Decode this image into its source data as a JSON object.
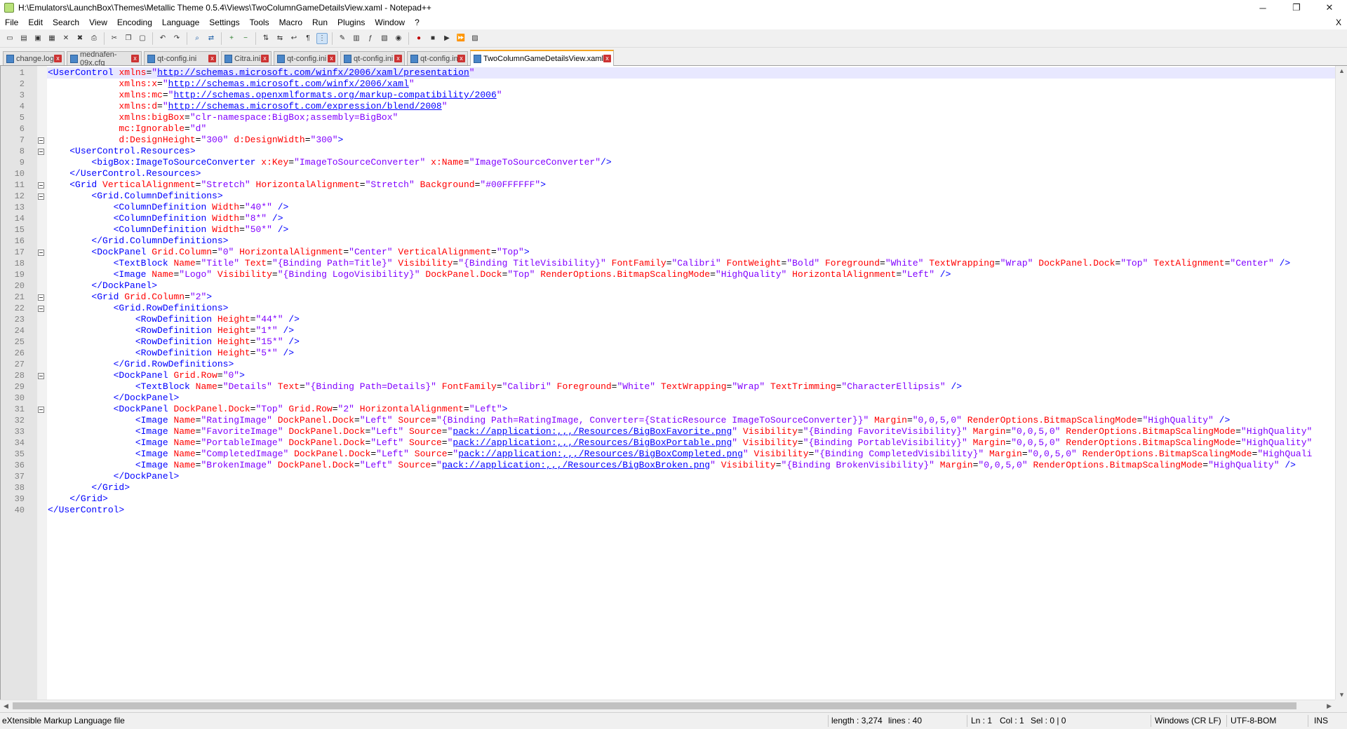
{
  "window": {
    "title": "H:\\Emulators\\LaunchBox\\Themes\\Metallic Theme 0.5.4\\Views\\TwoColumnGameDetailsView.xaml - Notepad++",
    "controls": [
      "─",
      "❐",
      "✕"
    ]
  },
  "menu": {
    "items": [
      "File",
      "Edit",
      "Search",
      "View",
      "Encoding",
      "Language",
      "Settings",
      "Tools",
      "Macro",
      "Run",
      "Plugins",
      "Window",
      "?"
    ],
    "close_label": "X"
  },
  "tabs": [
    {
      "label": "change.log",
      "active": false
    },
    {
      "label": "mednafen-09x.cfg",
      "active": false
    },
    {
      "label": "qt-config.ini",
      "active": false
    },
    {
      "label": "Citra.ini",
      "active": false
    },
    {
      "label": "qt-config.ini",
      "active": false
    },
    {
      "label": "qt-config.ini",
      "active": false
    },
    {
      "label": "qt-config.ini",
      "active": false
    },
    {
      "label": "TwoColumnGameDetailsView.xaml",
      "active": true
    }
  ],
  "tab_close_glyph": "x",
  "code_lines": [
    "<UserControl xmlns=\"http://schemas.microsoft.com/winfx/2006/xaml/presentation\"",
    "             xmlns:x=\"http://schemas.microsoft.com/winfx/2006/xaml\"",
    "             xmlns:mc=\"http://schemas.openxmlformats.org/markup-compatibility/2006\"",
    "             xmlns:d=\"http://schemas.microsoft.com/expression/blend/2008\"",
    "             xmlns:bigBox=\"clr-namespace:BigBox;assembly=BigBox\"",
    "             mc:Ignorable=\"d\"",
    "             d:DesignHeight=\"300\" d:DesignWidth=\"300\">",
    "    <UserControl.Resources>",
    "        <bigBox:ImageToSourceConverter x:Key=\"ImageToSourceConverter\" x:Name=\"ImageToSourceConverter\"/>",
    "    </UserControl.Resources>",
    "    <Grid VerticalAlignment=\"Stretch\" HorizontalAlignment=\"Stretch\" Background=\"#00FFFFFF\">",
    "        <Grid.ColumnDefinitions>",
    "            <ColumnDefinition Width=\"40*\" />",
    "            <ColumnDefinition Width=\"8*\" />",
    "            <ColumnDefinition Width=\"50*\" />",
    "        </Grid.ColumnDefinitions>",
    "        <DockPanel Grid.Column=\"0\" HorizontalAlignment=\"Center\" VerticalAlignment=\"Top\">",
    "            <TextBlock Name=\"Title\" Text=\"{Binding Path=Title}\" Visibility=\"{Binding TitleVisibility}\" FontFamily=\"Calibri\" FontWeight=\"Bold\" Foreground=\"White\" TextWrapping=\"Wrap\" DockPanel.Dock=\"Top\" TextAlignment=\"Center\" />",
    "            <Image Name=\"Logo\" Visibility=\"{Binding LogoVisibility}\" DockPanel.Dock=\"Top\" RenderOptions.BitmapScalingMode=\"HighQuality\" HorizontalAlignment=\"Left\" />",
    "        </DockPanel>",
    "        <Grid Grid.Column=\"2\">",
    "            <Grid.RowDefinitions>",
    "                <RowDefinition Height=\"44*\" />",
    "                <RowDefinition Height=\"1*\" />",
    "                <RowDefinition Height=\"15*\" />",
    "                <RowDefinition Height=\"5*\" />",
    "            </Grid.RowDefinitions>",
    "            <DockPanel Grid.Row=\"0\">",
    "                <TextBlock Name=\"Details\" Text=\"{Binding Path=Details}\" FontFamily=\"Calibri\" Foreground=\"White\" TextWrapping=\"Wrap\" TextTrimming=\"CharacterEllipsis\" />",
    "            </DockPanel>",
    "            <DockPanel DockPanel.Dock=\"Top\" Grid.Row=\"2\" HorizontalAlignment=\"Left\">",
    "                <Image Name=\"RatingImage\" DockPanel.Dock=\"Left\" Source=\"{Binding Path=RatingImage, Converter={StaticResource ImageToSourceConverter}}\" Margin=\"0,0,5,0\" RenderOptions.BitmapScalingMode=\"HighQuality\" />",
    "                <Image Name=\"FavoriteImage\" DockPanel.Dock=\"Left\" Source=\"pack://application:,,,/Resources/BigBoxFavorite.png\" Visibility=\"{Binding FavoriteVisibility}\" Margin=\"0,0,5,0\" RenderOptions.BitmapScalingMode=\"HighQuality\"",
    "                <Image Name=\"PortableImage\" DockPanel.Dock=\"Left\" Source=\"pack://application:,,,/Resources/BigBoxPortable.png\" Visibility=\"{Binding PortableVisibility}\" Margin=\"0,0,5,0\" RenderOptions.BitmapScalingMode=\"HighQuality\"",
    "                <Image Name=\"CompletedImage\" DockPanel.Dock=\"Left\" Source=\"pack://application:,,,/Resources/BigBoxCompleted.png\" Visibility=\"{Binding CompletedVisibility}\" Margin=\"0,0,5,0\" RenderOptions.BitmapScalingMode=\"HighQuali",
    "                <Image Name=\"BrokenImage\" DockPanel.Dock=\"Left\" Source=\"pack://application:,,,/Resources/BigBoxBroken.png\" Visibility=\"{Binding BrokenVisibility}\" Margin=\"0,0,5,0\" RenderOptions.BitmapScalingMode=\"HighQuality\" />",
    "            </DockPanel>",
    "        </Grid>",
    "    </Grid>",
    "</UserControl>"
  ],
  "fold_lines": [
    7,
    8,
    11,
    12,
    17,
    21,
    22,
    28,
    31
  ],
  "current_line": 1,
  "status": {
    "file_type": "eXtensible Markup Language file",
    "length": "length : 3,274",
    "lines": "lines : 40",
    "ln": "Ln : 1",
    "col": "Col : 1",
    "sel": "Sel : 0 | 0",
    "eol": "Windows (CR LF)",
    "encoding": "UTF-8-BOM",
    "mode": "INS"
  },
  "toolbar_icons": [
    "new-file-icon",
    "open-file-icon",
    "save-icon",
    "save-all-icon",
    "close-icon",
    "close-all-icon",
    "print-icon",
    "sep",
    "cut-icon",
    "copy-icon",
    "paste-icon",
    "sep",
    "undo-icon",
    "redo-icon",
    "sep",
    "find-icon",
    "replace-icon",
    "sep",
    "zoom-in-icon",
    "zoom-out-icon",
    "sep",
    "sync-vertical-icon",
    "sync-horizontal-icon",
    "word-wrap-icon",
    "show-all-chars-icon",
    "indent-guide-icon",
    "sep",
    "user-defined-language-icon",
    "document-map-icon",
    "function-list-icon",
    "folder-as-workspace-icon",
    "monitoring-icon",
    "sep",
    "record-macro-icon",
    "stop-recording-icon",
    "playback-macro-icon",
    "run-macro-multiple-icon",
    "save-macro-icon"
  ]
}
